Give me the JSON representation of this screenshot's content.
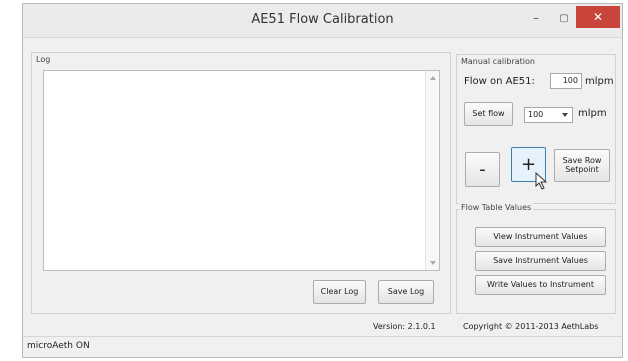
{
  "window": {
    "title": "AE51 Flow Calibration",
    "minimize_glyph": "–",
    "maximize_glyph": "▢",
    "close_glyph": "✕"
  },
  "log": {
    "label": "Log",
    "clear_button": "Clear Log",
    "save_button": "Save Log"
  },
  "manual": {
    "label": "Manual calibration",
    "flow_label": "Flow on AE51:",
    "flow_value": "100",
    "flow_unit": "mlpm",
    "set_flow_button": "Set flow",
    "set_flow_value": "100",
    "set_flow_unit": "mlpm",
    "minus_label": "-",
    "plus_label": "+",
    "save_setpoint_button": "Save Row Setpoint"
  },
  "flow_table": {
    "label": "Flow Table Values",
    "view_button": "View Instrument Values",
    "save_button": "Save Instrument Values",
    "write_button": "Write Values to Instrument"
  },
  "footer": {
    "version": "Version: 2.1.0.1",
    "copyright": "Copyright © 2011-2013 AethLabs"
  },
  "status": {
    "text": "microAeth ON"
  },
  "colors": {
    "close_button": "#c9453b",
    "active_button": "#e5f1fb"
  }
}
